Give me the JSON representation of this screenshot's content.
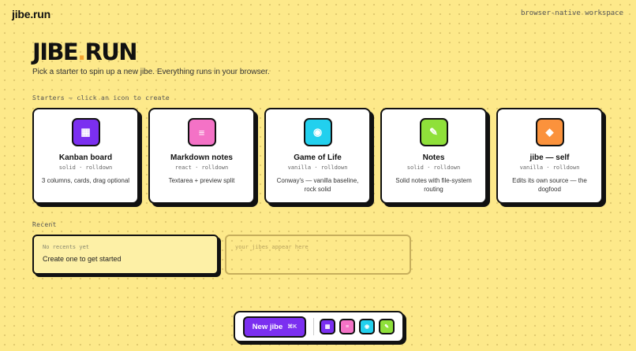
{
  "header": {
    "logo": "jibe.run",
    "tagline": "browser-native workspace"
  },
  "hero": {
    "title_a": "JIBE",
    "title_dot": ".",
    "title_b": "RUN",
    "subtitle": "Pick a starter to spin up a new jibe. Everything runs in your browser."
  },
  "starters": {
    "label": "Starters — click an icon to create",
    "cards": [
      {
        "title": "Kanban board",
        "meta": "solid · rolldown",
        "desc": "3 columns, cards, drag optional",
        "icon": "grid-icon",
        "glyph": "▦",
        "color": "#7b2ff0"
      },
      {
        "title": "Markdown notes",
        "meta": "react · rolldown",
        "desc": "Textarea + preview split",
        "icon": "lines-icon",
        "glyph": "≡",
        "color": "#f472c6"
      },
      {
        "title": "Game of Life",
        "meta": "vanilla · rolldown",
        "desc": "Conway's — vanilla baseline, rock solid",
        "icon": "cell-icon",
        "glyph": "◉",
        "color": "#22d0ee"
      },
      {
        "title": "Notes",
        "meta": "solid · rolldown",
        "desc": "Solid notes with file-system routing",
        "icon": "pencil-icon",
        "glyph": "✎",
        "color": "#8fe03a"
      },
      {
        "title": "jibe — self",
        "meta": "vanilla · rolldown",
        "desc": "Edits its own source — the dogfood",
        "icon": "diamond-icon",
        "glyph": "◆",
        "color": "#fb923c"
      }
    ]
  },
  "recent": {
    "label": "Recent",
    "empty_small": "No recents yet",
    "empty_text": "Create one to get started",
    "placeholder": "your jibes appear here"
  },
  "dock": {
    "new_label": "New jibe",
    "shortcut": "⌘K",
    "icons": [
      {
        "name": "grid-icon",
        "glyph": "▦",
        "color": "#7b2ff0"
      },
      {
        "name": "lines-icon",
        "glyph": "≡",
        "color": "#f472c6"
      },
      {
        "name": "cell-icon",
        "glyph": "◉",
        "color": "#22d0ee"
      },
      {
        "name": "pencil-icon",
        "glyph": "✎",
        "color": "#8fe03a"
      }
    ]
  }
}
